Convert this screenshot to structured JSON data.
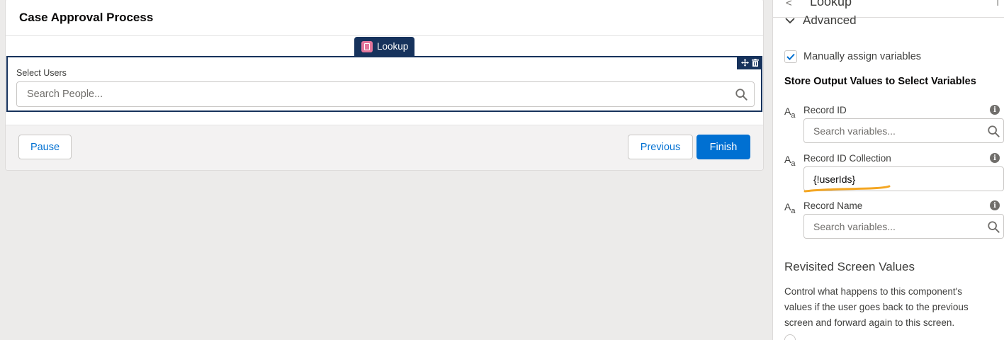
{
  "screen": {
    "title": "Case Approval Process",
    "component_tag": "Lookup",
    "field_label": "Select Users",
    "search_placeholder": "Search People...",
    "buttons": {
      "pause": "Pause",
      "previous": "Previous",
      "finish": "Finish"
    }
  },
  "panel": {
    "title": "Lookup",
    "section": "Advanced",
    "manual_assign_label": "Manually assign variables",
    "manual_assign_checked": true,
    "store_title": "Store Output Values to Select Variables",
    "variables": [
      {
        "label": "Record ID",
        "value": "",
        "placeholder": "Search variables..."
      },
      {
        "label": "Record ID Collection",
        "value": "{!userIds}",
        "placeholder": ""
      },
      {
        "label": "Record Name",
        "value": "",
        "placeholder": "Search variables..."
      }
    ],
    "revisit_title": "Revisited Screen Values",
    "revisit_desc": "Control what happens to this component's values if the user goes back to the previous screen and forward again to this screen."
  },
  "colors": {
    "brand": "#0070d2",
    "selection": "#16325c",
    "annotation": "#f4a622"
  },
  "icons": [
    "lookup-icon",
    "move-icon",
    "delete-icon",
    "search-icon",
    "chevron-down-icon",
    "checkmark-icon",
    "text-type-icon",
    "info-icon",
    "back-chevron-icon"
  ]
}
